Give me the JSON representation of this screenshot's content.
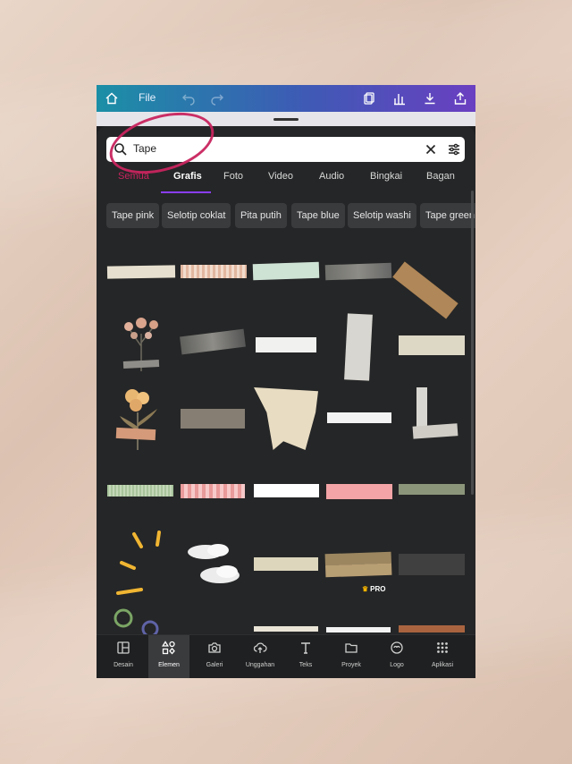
{
  "topbar": {
    "file_label": "File"
  },
  "search": {
    "value": "Tape",
    "placeholder": "Tape"
  },
  "tabs": [
    {
      "label": "Semua"
    },
    {
      "label": "Grafis"
    },
    {
      "label": "Foto"
    },
    {
      "label": "Video"
    },
    {
      "label": "Audio"
    },
    {
      "label": "Bingkai"
    },
    {
      "label": "Bagan"
    }
  ],
  "active_tab": "Grafis",
  "chips": [
    {
      "label": "Tape pink"
    },
    {
      "label": "Selotip coklat"
    },
    {
      "label": "Pita putih"
    },
    {
      "label": "Tape blue"
    },
    {
      "label": "Selotip washi"
    },
    {
      "label": "Tape green"
    }
  ],
  "pro_badge": "PRO",
  "nav": [
    {
      "label": "Desain",
      "icon": "layout-icon"
    },
    {
      "label": "Elemen",
      "icon": "shapes-icon"
    },
    {
      "label": "Galeri",
      "icon": "camera-icon"
    },
    {
      "label": "Unggahan",
      "icon": "cloud-upload-icon"
    },
    {
      "label": "Teks",
      "icon": "text-icon"
    },
    {
      "label": "Proyek",
      "icon": "folder-icon"
    },
    {
      "label": "Logo",
      "icon": "logo-icon"
    },
    {
      "label": "Aplikasi",
      "icon": "apps-grid-icon"
    }
  ],
  "active_nav": "Elemen",
  "colors": {
    "accent": "#8b3dff",
    "annotation": "#c8245e",
    "panel": "#252627"
  }
}
